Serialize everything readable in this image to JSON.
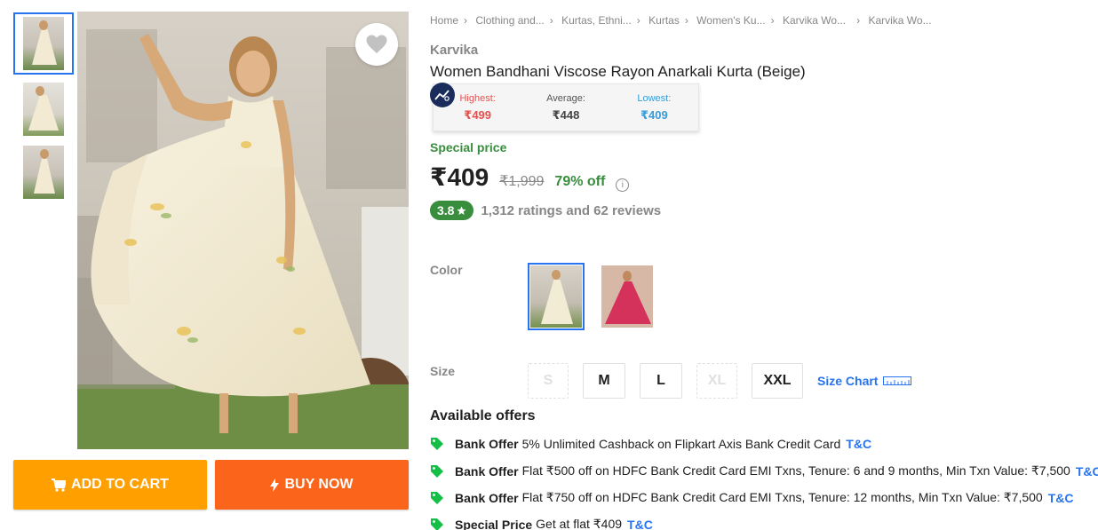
{
  "gallery": {
    "thumbnails": [
      "thumb-1",
      "thumb-2",
      "thumb-3"
    ],
    "wishlist_icon": "heart-icon"
  },
  "actions": {
    "add_to_cart": "ADD TO CART",
    "buy_now": "BUY NOW",
    "cart_icon": "cart-icon",
    "bolt_icon": "lightning-icon"
  },
  "breadcrumbs": [
    "Home",
    "Clothing and...",
    "Kurtas, Ethni...",
    "Kurtas",
    "Women's Ku...",
    "Karvika Wo...",
    "Karvika Wo..."
  ],
  "product": {
    "brand": "Karvika",
    "title": "Women Bandhani Viscose Rayon Anarkali Kurta  (Beige)",
    "special_label": "Special price",
    "price": "₹409",
    "mrp": "₹1,999",
    "discount": "79% off",
    "rating": "3.8",
    "rating_text": "1,312 ratings and 62 reviews"
  },
  "price_history": {
    "highest_label": "Highest:",
    "highest": "₹499",
    "average_label": "Average:",
    "average": "₹448",
    "lowest_label": "Lowest:",
    "lowest": "₹409"
  },
  "color": {
    "label": "Color",
    "options": [
      "beige",
      "pink"
    ],
    "selected": "beige"
  },
  "size": {
    "label": "Size",
    "options": [
      {
        "label": "S",
        "available": false
      },
      {
        "label": "M",
        "available": true
      },
      {
        "label": "L",
        "available": true
      },
      {
        "label": "XL",
        "available": false
      },
      {
        "label": "XXL",
        "available": true
      }
    ],
    "chart_label": "Size Chart"
  },
  "offers": {
    "title": "Available offers",
    "items": [
      {
        "kind": "Bank Offer",
        "text": "5% Unlimited Cashback on Flipkart Axis Bank Credit Card",
        "tc": "T&C"
      },
      {
        "kind": "Bank Offer",
        "text": "Flat ₹500 off on HDFC Bank Credit Card EMI Txns, Tenure: 6 and 9 months, Min Txn Value: ₹7,500",
        "tc": "T&C"
      },
      {
        "kind": "Bank Offer",
        "text": "Flat ₹750 off on HDFC Bank Credit Card EMI Txns, Tenure: 12 months, Min Txn Value: ₹7,500",
        "tc": "T&C"
      },
      {
        "kind": "Special Price",
        "text": "Get at flat ₹409",
        "tc": "T&C"
      }
    ]
  },
  "colors": {
    "primary": "#2874f0",
    "cart": "#ff9f00",
    "buy": "#fb641b",
    "green": "#388e3c"
  }
}
